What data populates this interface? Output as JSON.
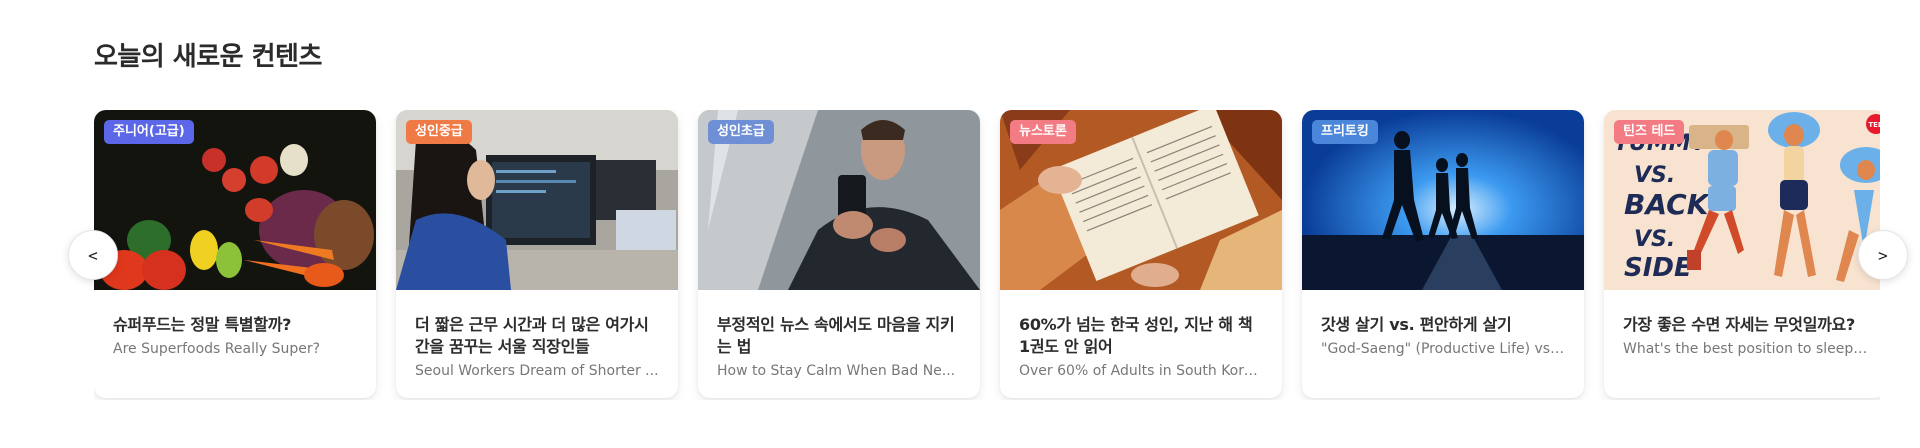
{
  "section": {
    "title": "오늘의 새로운 컨텐츠"
  },
  "nav": {
    "prev_label": "<",
    "next_label": ">"
  },
  "cards": [
    {
      "badge": "주니어(고급)",
      "badge_color": "#5b67e8",
      "title": "슈퍼푸드는 정말 특별할까?",
      "subtitle": "Are Superfoods Really Super?"
    },
    {
      "badge": "성인중급",
      "badge_color": "#f07a45",
      "title": "더 짧은 근무 시간과 더 많은 여가시간을 꿈꾸는 서울 직장인들",
      "subtitle": "Seoul Workers Dream of Shorter ..."
    },
    {
      "badge": "성인초급",
      "badge_color": "#6e8fd6",
      "title": "부정적인 뉴스 속에서도 마음을 지키는 법",
      "subtitle": "How to Stay Calm When Bad Ne..."
    },
    {
      "badge": "뉴스토론",
      "badge_color": "#f37b83",
      "title": "60%가 넘는 한국 성인, 지난 해 책 1권도 안 읽어",
      "subtitle": "Over 60% of Adults in South Kore..."
    },
    {
      "badge": "프리토킹",
      "badge_color": "#4a86d9",
      "title": "갓생 살기 vs. 편안하게 살기",
      "subtitle": "\"God-Saeng\" (Productive Life) vs...."
    },
    {
      "badge": "틴즈 테드",
      "badge_color": "#f37b83",
      "title": "가장 좋은 수면 자세는 무엇일까요?",
      "subtitle": "What's the best position to sleep i..."
    }
  ],
  "thumbnails": {
    "illustration_words": [
      "TUMMY",
      "VS.",
      "BACK",
      "VS.",
      "SIDE"
    ],
    "ted_logo": "TED"
  }
}
